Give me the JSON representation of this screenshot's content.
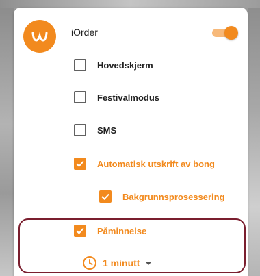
{
  "app": {
    "name": "iOrder",
    "icon": "w-logo-icon",
    "toggle_on": true
  },
  "options": [
    {
      "label": "Hovedskjerm",
      "checked": false
    },
    {
      "label": "Festivalmodus",
      "checked": false
    },
    {
      "label": "SMS",
      "checked": false
    },
    {
      "label": "Automatisk utskrift av bong",
      "checked": true
    },
    {
      "label": "Bakgrunnsprosessering",
      "checked": true
    },
    {
      "label": "Påminnelse",
      "checked": true
    }
  ],
  "reminder": {
    "value": "1 minutt",
    "icon": "clock-icon"
  },
  "colors": {
    "accent": "#f28a1e",
    "highlight_border": "#7a1e2e"
  }
}
